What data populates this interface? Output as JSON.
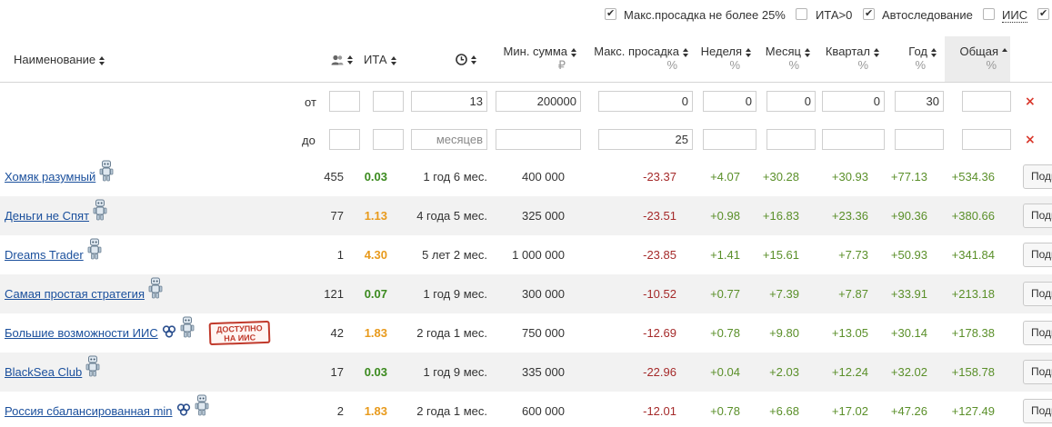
{
  "filters_bar": {
    "options": [
      {
        "label": "Макс.просадка не более 25%",
        "checked": true
      },
      {
        "label": "ИТА>0",
        "checked": false
      },
      {
        "label": "Автоследование",
        "checked": true
      },
      {
        "label": "ИИС",
        "checked": false
      },
      {
        "label": "",
        "checked": true
      }
    ]
  },
  "columns": {
    "name": "Наименование",
    "ita": "ИТА",
    "min_sum": "Мин. сумма",
    "min_sum_unit": "₽",
    "drawdown": "Макс. просадка",
    "drawdown_unit": "%",
    "week": "Неделя",
    "week_unit": "%",
    "month": "Месяц",
    "month_unit": "%",
    "quarter": "Квартал",
    "quarter_unit": "%",
    "year": "Год",
    "year_unit": "%",
    "total": "Общая",
    "total_unit": "%"
  },
  "filter_rows": {
    "from_label": "от",
    "to_label": "до",
    "from": {
      "subs": "",
      "ita": "",
      "age": "13",
      "min_sum": "200000",
      "drawdown": "0",
      "week": "0",
      "month": "0",
      "quarter": "0",
      "year": "30",
      "total": ""
    },
    "to": {
      "subs": "",
      "ita": "",
      "age_placeholder": "месяцев",
      "min_sum": "",
      "drawdown": "25",
      "week": "",
      "month": "",
      "quarter": "",
      "year": "",
      "total": ""
    },
    "clear_symbol": "×"
  },
  "rows": [
    {
      "name": "Хомяк разумный",
      "subs": "455",
      "ita": "0.03",
      "ita_level": "green",
      "age": "1 год 6 мес.",
      "min_sum": "400 000",
      "drawdown": "-23.37",
      "week": "+4.07",
      "month": "+30.28",
      "quarter": "+30.93",
      "year": "+77.13",
      "total": "+534.36",
      "button": "Подключить"
    },
    {
      "name": "Деньги не Спят",
      "subs": "77",
      "ita": "1.13",
      "ita_level": "orange",
      "age": "4 года 5 мес.",
      "min_sum": "325 000",
      "drawdown": "-23.51",
      "week": "+0.98",
      "month": "+16.83",
      "quarter": "+23.36",
      "year": "+90.36",
      "total": "+380.66",
      "button": "Подключить"
    },
    {
      "name": "Dreams Trader",
      "subs": "1",
      "ita": "4.30",
      "ita_level": "orange",
      "age": "5 лет 2 мес.",
      "min_sum": "1 000 000",
      "drawdown": "-23.85",
      "week": "+1.41",
      "month": "+15.61",
      "quarter": "+7.73",
      "year": "+50.93",
      "total": "+341.84",
      "button": "Подключить"
    },
    {
      "name": "Самая простая стратегия",
      "subs": "121",
      "ita": "0.07",
      "ita_level": "green",
      "age": "1 год 9 мес.",
      "min_sum": "300 000",
      "drawdown": "-10.52",
      "week": "+0.77",
      "month": "+7.39",
      "quarter": "+7.87",
      "year": "+33.91",
      "total": "+213.18",
      "button": "Подключить"
    },
    {
      "name": "Большие возможности ИИС",
      "subs": "42",
      "ita": "1.83",
      "ita_level": "orange",
      "age": "2 года 1 мес.",
      "min_sum": "750 000",
      "drawdown": "-12.69",
      "week": "+0.78",
      "month": "+9.80",
      "quarter": "+13.05",
      "year": "+30.14",
      "total": "+178.38",
      "button": "Подключить",
      "badge": "ДОСТУПНО НА ИИС"
    },
    {
      "name": "BlackSea Club",
      "subs": "17",
      "ita": "0.03",
      "ita_level": "green",
      "age": "1 год 9 мес.",
      "min_sum": "335 000",
      "drawdown": "-22.96",
      "week": "+0.04",
      "month": "+2.03",
      "quarter": "+12.24",
      "year": "+32.02",
      "total": "+158.78",
      "button": "Подключить"
    },
    {
      "name": "Россия сбалансированная min",
      "subs": "2",
      "ita": "1.83",
      "ita_level": "orange",
      "age": "2 года 1 мес.",
      "min_sum": "600 000",
      "drawdown": "-12.01",
      "week": "+0.78",
      "month": "+6.68",
      "quarter": "+17.02",
      "year": "+47.26",
      "total": "+127.49",
      "button": "Подключить"
    }
  ]
}
